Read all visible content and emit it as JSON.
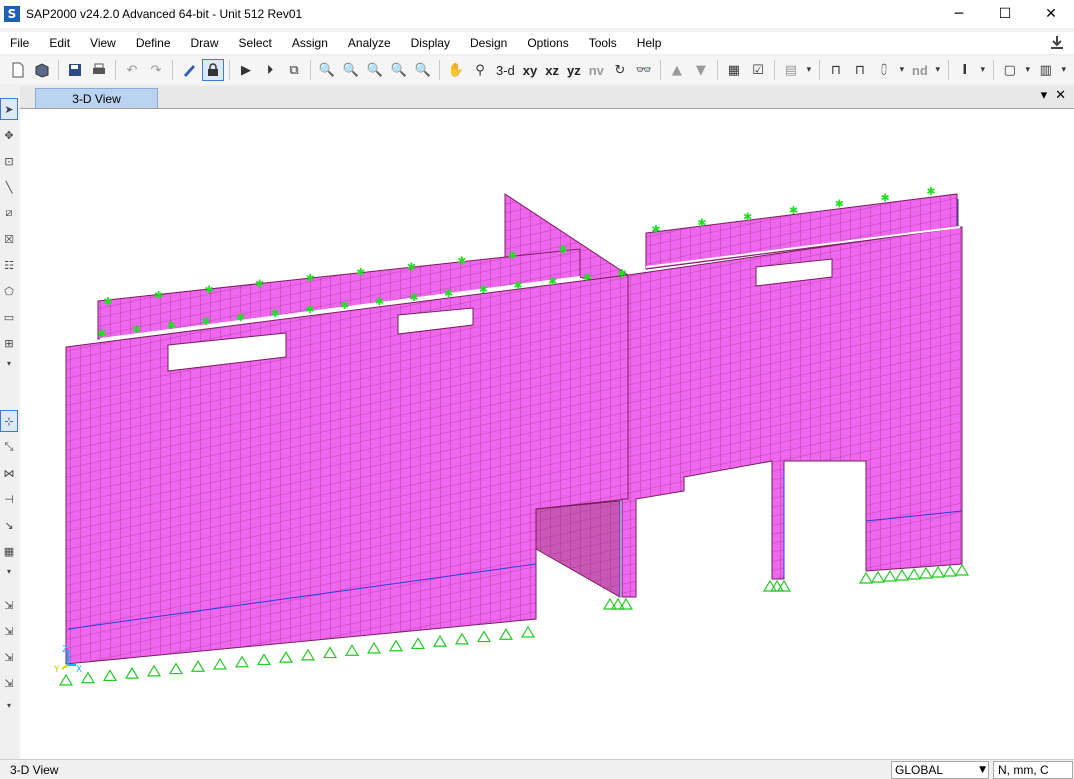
{
  "window": {
    "title": "SAP2000 v24.2.0 Advanced 64-bit - Unit 512 Rev01",
    "app_icon_letter": "S",
    "minimize": "─",
    "maximize": "☐",
    "close": "✕"
  },
  "menu": [
    "File",
    "Edit",
    "View",
    "Define",
    "Draw",
    "Select",
    "Assign",
    "Analyze",
    "Display",
    "Design",
    "Options",
    "Tools",
    "Help"
  ],
  "toolbar": {
    "view_3d": "3-d",
    "view_xy": "xy",
    "view_xz": "xz",
    "view_yz": "yz",
    "view_nv": "nv",
    "nd": "nd"
  },
  "tab": {
    "label": "3-D View",
    "dropdown": "▾",
    "close": "✕"
  },
  "status": {
    "view_name": "3-D View",
    "coord_system": "GLOBAL",
    "units": "N, mm, C"
  },
  "axes": {
    "z": "Z",
    "x": "X",
    "y": "Y"
  },
  "colors": {
    "shell": "#ef66ef",
    "mesh": "#7a1e5a",
    "support": "#22c922",
    "load": "#22dd22",
    "frame": "#2a40d8",
    "tab_active": "#b9d3f0"
  }
}
